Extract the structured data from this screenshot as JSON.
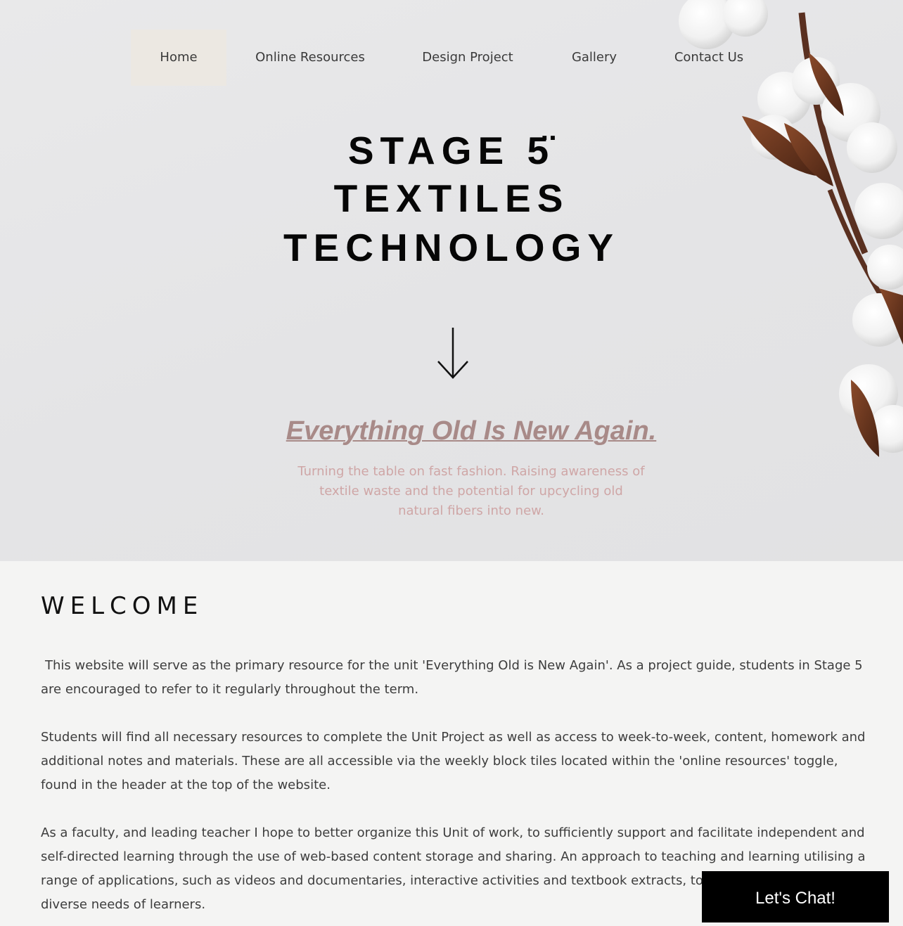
{
  "nav": {
    "items": [
      {
        "label": "Home",
        "active": true
      },
      {
        "label": "Online Resources",
        "active": false
      },
      {
        "label": "Design Project",
        "active": false
      },
      {
        "label": "Gallery",
        "active": false
      },
      {
        "label": "Contact Us",
        "active": false
      }
    ]
  },
  "hero": {
    "title_lines": [
      "STAGE 5̈",
      "TEXTILES",
      "TECHNOLOGY"
    ],
    "arrow_icon": "down-arrow-icon",
    "tagline": "Everything Old Is New Again.",
    "subtitle": "Turning the table on fast fashion. Raising awareness of textile waste and the potential for upcycling old natural fibers into new."
  },
  "welcome": {
    "heading": "WELCOME",
    "paragraphs": [
      "This website will serve as the primary resource for the unit 'Everything Old is New Again'. As a project guide, students in Stage 5 are encouraged to refer to it regularly throughout the term.",
      "Students will find all necessary resources to complete the Unit Project as well as access to week-to-week, content, homework and additional notes and materials. These are all accessible via the weekly block tiles located within the 'online resources' toggle, found in the header at the top of the website.",
      "As a faculty, and leading teacher I hope to better organize this Unit of work, to sufficiently support and facilitate independent and self-directed learning through the use of web-based content storage and sharing. An approach to teaching and learning utilising a range of applications, such as videos and documentaries, interactive activities and textbook extracts, to adequately meet the diverse needs of learners."
    ]
  },
  "chat": {
    "label": "Let's Chat!"
  },
  "colors": {
    "nav_active_bg": "#ece8e2",
    "tagline": "#a88a88",
    "subtitle": "#cfa6a6",
    "chat_bg": "#000000"
  }
}
